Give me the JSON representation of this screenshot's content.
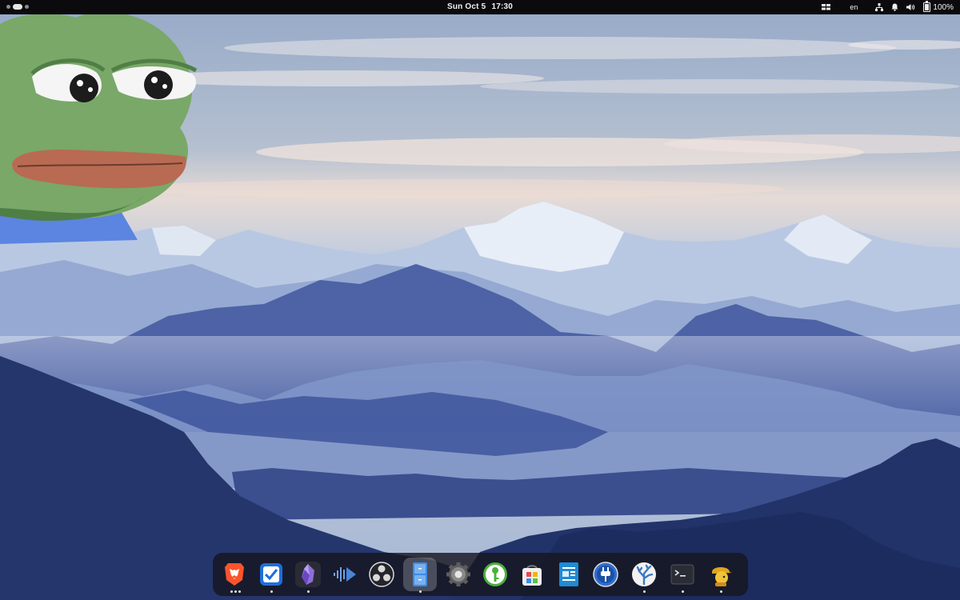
{
  "topbar": {
    "date": "Sun Oct 5",
    "time": "17:30",
    "language": "en",
    "battery_level": "100%"
  },
  "dock": {
    "apps": [
      {
        "name": "Brave",
        "running": true,
        "windows": 3
      },
      {
        "name": "Tasks",
        "running": true,
        "windows": 1
      },
      {
        "name": "Obsidian",
        "running": true,
        "windows": 1
      },
      {
        "name": "Audio Sharing",
        "running": false,
        "windows": 0
      },
      {
        "name": "OBS Studio",
        "running": false,
        "windows": 0
      },
      {
        "name": "Files",
        "running": true,
        "windows": 1,
        "active": true
      },
      {
        "name": "Settings",
        "running": false,
        "windows": 0
      },
      {
        "name": "KeePassXC",
        "running": false,
        "windows": 0
      },
      {
        "name": "Software",
        "running": false,
        "windows": 0
      },
      {
        "name": "Text Editor",
        "running": false,
        "windows": 0
      },
      {
        "name": "Extension Manager",
        "running": false,
        "windows": 0
      },
      {
        "name": "Flathub",
        "running": true,
        "windows": 1
      },
      {
        "name": "Terminal",
        "running": true,
        "windows": 1
      },
      {
        "name": "Mousam",
        "running": true,
        "windows": 1
      }
    ]
  },
  "colors": {
    "topbar_bg": "#0b0b0d",
    "dock_bg": "#16161e",
    "sky_top": "#9fb2cf",
    "mountain_far": "#a9bbd9",
    "mountain_mid": "#5f76b3",
    "mountain_near": "#24356b"
  },
  "icons": [
    "activities-indicator",
    "dash-icon",
    "network-icon",
    "notification-icon",
    "volume-icon",
    "battery-icon"
  ]
}
